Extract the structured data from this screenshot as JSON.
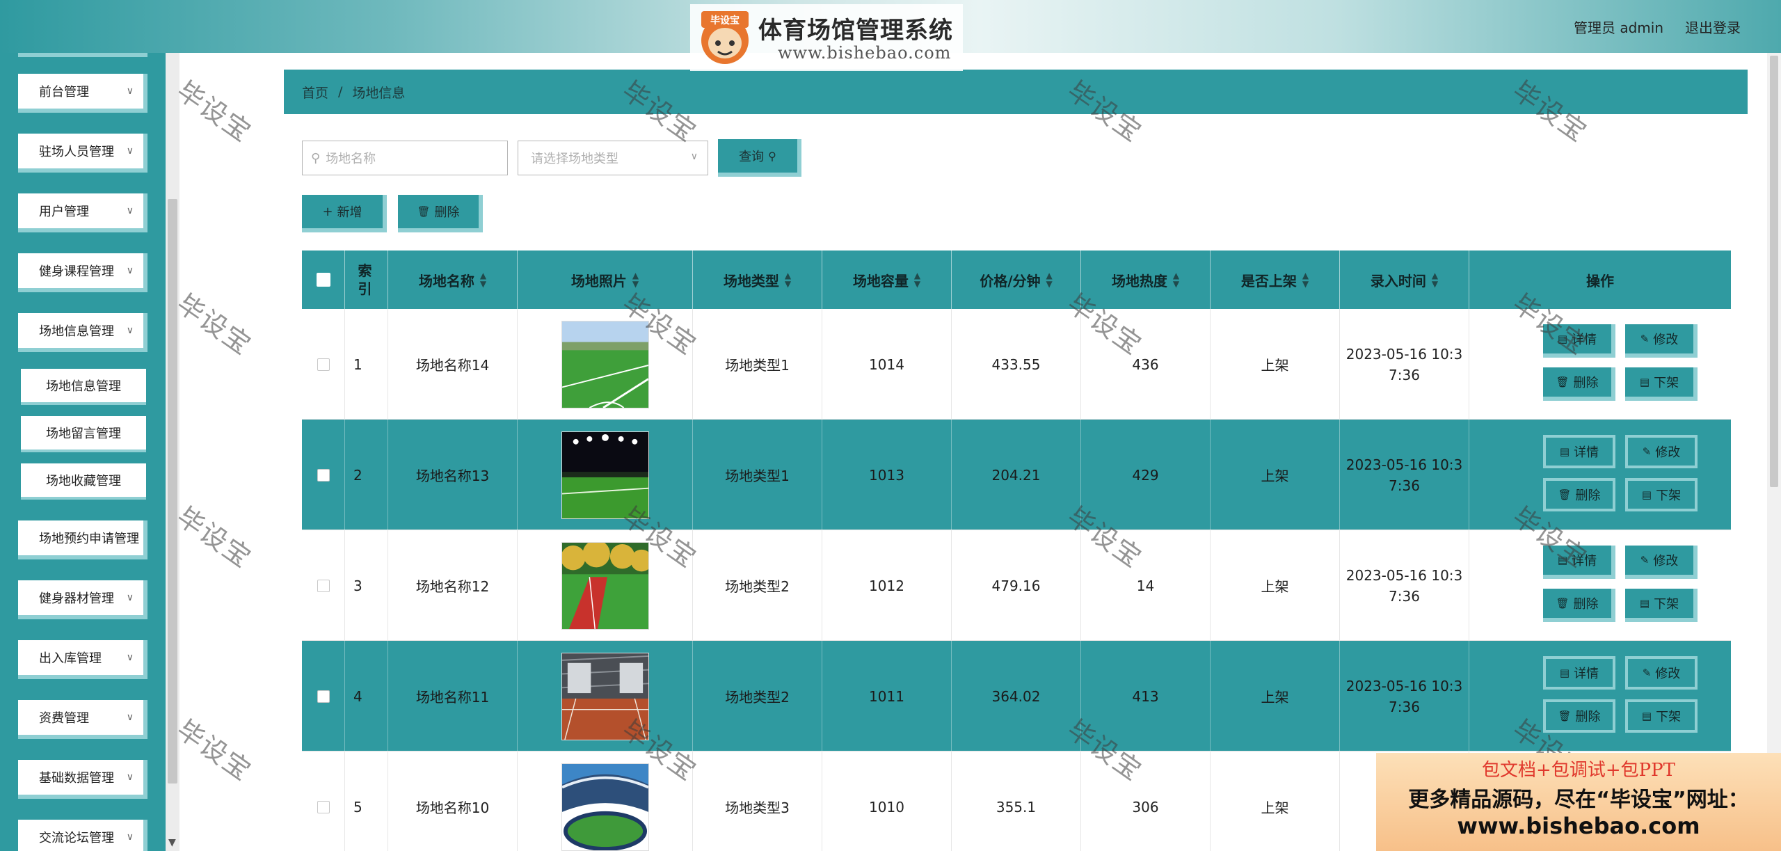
{
  "header": {
    "title": "体育场馆管理系统",
    "logo_url_text": "www.bishebao.com",
    "logo_badge": "毕设宝",
    "admin_label": "管理员 admin",
    "logout_label": "退出登录"
  },
  "sidebar": {
    "items": [
      {
        "label": "前台管理"
      },
      {
        "label": "驻场人员管理"
      },
      {
        "label": "用户管理"
      },
      {
        "label": "健身课程管理"
      },
      {
        "label": "场地信息管理"
      },
      {
        "label": "场地预约申请管理"
      },
      {
        "label": "健身器材管理"
      },
      {
        "label": "出入库管理"
      },
      {
        "label": "资费管理"
      },
      {
        "label": "基础数据管理"
      },
      {
        "label": "交流论坛管理"
      }
    ],
    "subitems": [
      {
        "label": "场地信息管理"
      },
      {
        "label": "场地留言管理"
      },
      {
        "label": "场地收藏管理"
      }
    ]
  },
  "breadcrumb": {
    "home": "首页",
    "sep": "/",
    "current": "场地信息"
  },
  "search": {
    "name_placeholder": "场地名称",
    "type_placeholder": "请选择场地类型",
    "query_label": "查询",
    "add_label": "新增",
    "delete_label": "删除"
  },
  "table": {
    "headers": {
      "index": "索引",
      "name": "场地名称",
      "photo": "场地照片",
      "type": "场地类型",
      "capacity": "场地容量",
      "price": "价格/分钟",
      "heat": "场地热度",
      "listed": "是否上架",
      "time": "录入时间",
      "ops": "操作"
    },
    "rows": [
      {
        "index": "1",
        "name": "场地名称14",
        "type": "场地类型1",
        "capacity": "1014",
        "price": "433.55",
        "heat": "436",
        "listed": "上架",
        "time1": "2023-05-16 10:3",
        "time2": "7:36"
      },
      {
        "index": "2",
        "name": "场地名称13",
        "type": "场地类型1",
        "capacity": "1013",
        "price": "204.21",
        "heat": "429",
        "listed": "上架",
        "time1": "2023-05-16 10:3",
        "time2": "7:36"
      },
      {
        "index": "3",
        "name": "场地名称12",
        "type": "场地类型2",
        "capacity": "1012",
        "price": "479.16",
        "heat": "14",
        "listed": "上架",
        "time1": "2023-05-16 10:3",
        "time2": "7:36"
      },
      {
        "index": "4",
        "name": "场地名称11",
        "type": "场地类型2",
        "capacity": "1011",
        "price": "364.02",
        "heat": "413",
        "listed": "上架",
        "time1": "2023-05-16 10:3",
        "time2": "7:36"
      },
      {
        "index": "5",
        "name": "场地名称10",
        "type": "场地类型3",
        "capacity": "1010",
        "price": "355.1",
        "heat": "306",
        "listed": "上架",
        "time1": "2023",
        "time2": ""
      }
    ],
    "actions": {
      "detail": "详情",
      "edit": "修改",
      "delete": "删除",
      "unlist": "下架"
    }
  },
  "watermark": "毕设宝",
  "promo": {
    "line1": "包文档+包调试+包PPT",
    "line2": "更多精品源码，尽在“毕设宝”网址：",
    "line3": "www.bishebao.com"
  },
  "colors": {
    "accent": "#2f9aa0",
    "accent_light": "#8fcfd3"
  }
}
